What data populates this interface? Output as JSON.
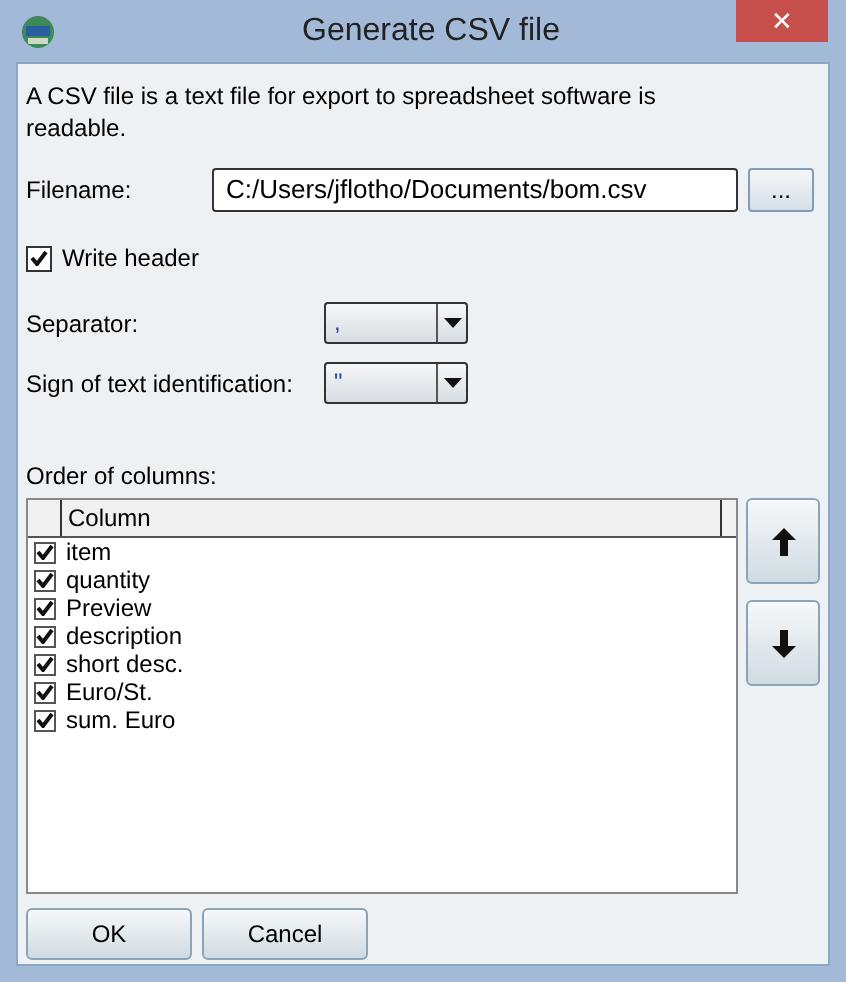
{
  "window": {
    "title": "Generate CSV file",
    "close": "✕"
  },
  "intro": "A CSV file is a text file for export to spreadsheet software is readable.",
  "filename": {
    "label": "Filename:",
    "value": "C:/Users/jflotho/Documents/bom.csv",
    "browse": "..."
  },
  "write_header": {
    "label": "Write header",
    "checked": true
  },
  "separator": {
    "label": "Separator:",
    "value": ","
  },
  "text_sign": {
    "label": "Sign of text identification:",
    "value": "\""
  },
  "columns": {
    "label": "Order of columns:",
    "header": "Column",
    "items": [
      {
        "name": "item",
        "checked": true
      },
      {
        "name": "quantity",
        "checked": true
      },
      {
        "name": "Preview",
        "checked": true
      },
      {
        "name": "description",
        "checked": true
      },
      {
        "name": "short desc.",
        "checked": true
      },
      {
        "name": "Euro/St.",
        "checked": true
      },
      {
        "name": "sum. Euro",
        "checked": true
      }
    ]
  },
  "buttons": [
    "OK",
    "Cancel"
  ]
}
